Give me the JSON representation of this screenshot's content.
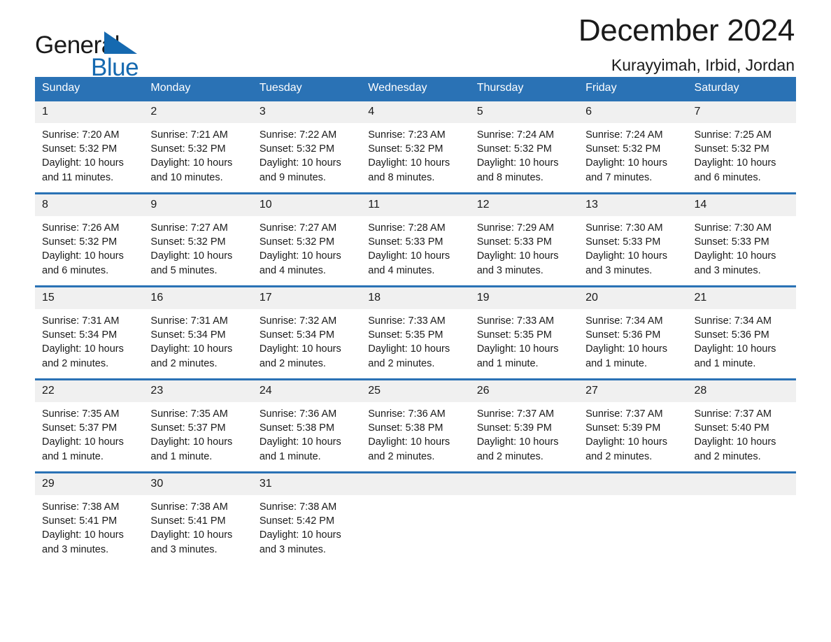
{
  "brand": {
    "name_part1": "General",
    "name_part2": "Blue",
    "logo_icon": "triangle-flag-icon"
  },
  "header": {
    "title": "December 2024",
    "location": "Kurayyimah, Irbid, Jordan"
  },
  "calendar": {
    "weekday_headers": [
      "Sunday",
      "Monday",
      "Tuesday",
      "Wednesday",
      "Thursday",
      "Friday",
      "Saturday"
    ],
    "accent_color": "#2a72b5",
    "daynum_band_color": "#f0f0f0",
    "weeks": [
      [
        {
          "day": "1",
          "sunrise": "Sunrise: 7:20 AM",
          "sunset": "Sunset: 5:32 PM",
          "daylight": "Daylight: 10 hours and 11 minutes."
        },
        {
          "day": "2",
          "sunrise": "Sunrise: 7:21 AM",
          "sunset": "Sunset: 5:32 PM",
          "daylight": "Daylight: 10 hours and 10 minutes."
        },
        {
          "day": "3",
          "sunrise": "Sunrise: 7:22 AM",
          "sunset": "Sunset: 5:32 PM",
          "daylight": "Daylight: 10 hours and 9 minutes."
        },
        {
          "day": "4",
          "sunrise": "Sunrise: 7:23 AM",
          "sunset": "Sunset: 5:32 PM",
          "daylight": "Daylight: 10 hours and 8 minutes."
        },
        {
          "day": "5",
          "sunrise": "Sunrise: 7:24 AM",
          "sunset": "Sunset: 5:32 PM",
          "daylight": "Daylight: 10 hours and 8 minutes."
        },
        {
          "day": "6",
          "sunrise": "Sunrise: 7:24 AM",
          "sunset": "Sunset: 5:32 PM",
          "daylight": "Daylight: 10 hours and 7 minutes."
        },
        {
          "day": "7",
          "sunrise": "Sunrise: 7:25 AM",
          "sunset": "Sunset: 5:32 PM",
          "daylight": "Daylight: 10 hours and 6 minutes."
        }
      ],
      [
        {
          "day": "8",
          "sunrise": "Sunrise: 7:26 AM",
          "sunset": "Sunset: 5:32 PM",
          "daylight": "Daylight: 10 hours and 6 minutes."
        },
        {
          "day": "9",
          "sunrise": "Sunrise: 7:27 AM",
          "sunset": "Sunset: 5:32 PM",
          "daylight": "Daylight: 10 hours and 5 minutes."
        },
        {
          "day": "10",
          "sunrise": "Sunrise: 7:27 AM",
          "sunset": "Sunset: 5:32 PM",
          "daylight": "Daylight: 10 hours and 4 minutes."
        },
        {
          "day": "11",
          "sunrise": "Sunrise: 7:28 AM",
          "sunset": "Sunset: 5:33 PM",
          "daylight": "Daylight: 10 hours and 4 minutes."
        },
        {
          "day": "12",
          "sunrise": "Sunrise: 7:29 AM",
          "sunset": "Sunset: 5:33 PM",
          "daylight": "Daylight: 10 hours and 3 minutes."
        },
        {
          "day": "13",
          "sunrise": "Sunrise: 7:30 AM",
          "sunset": "Sunset: 5:33 PM",
          "daylight": "Daylight: 10 hours and 3 minutes."
        },
        {
          "day": "14",
          "sunrise": "Sunrise: 7:30 AM",
          "sunset": "Sunset: 5:33 PM",
          "daylight": "Daylight: 10 hours and 3 minutes."
        }
      ],
      [
        {
          "day": "15",
          "sunrise": "Sunrise: 7:31 AM",
          "sunset": "Sunset: 5:34 PM",
          "daylight": "Daylight: 10 hours and 2 minutes."
        },
        {
          "day": "16",
          "sunrise": "Sunrise: 7:31 AM",
          "sunset": "Sunset: 5:34 PM",
          "daylight": "Daylight: 10 hours and 2 minutes."
        },
        {
          "day": "17",
          "sunrise": "Sunrise: 7:32 AM",
          "sunset": "Sunset: 5:34 PM",
          "daylight": "Daylight: 10 hours and 2 minutes."
        },
        {
          "day": "18",
          "sunrise": "Sunrise: 7:33 AM",
          "sunset": "Sunset: 5:35 PM",
          "daylight": "Daylight: 10 hours and 2 minutes."
        },
        {
          "day": "19",
          "sunrise": "Sunrise: 7:33 AM",
          "sunset": "Sunset: 5:35 PM",
          "daylight": "Daylight: 10 hours and 1 minute."
        },
        {
          "day": "20",
          "sunrise": "Sunrise: 7:34 AM",
          "sunset": "Sunset: 5:36 PM",
          "daylight": "Daylight: 10 hours and 1 minute."
        },
        {
          "day": "21",
          "sunrise": "Sunrise: 7:34 AM",
          "sunset": "Sunset: 5:36 PM",
          "daylight": "Daylight: 10 hours and 1 minute."
        }
      ],
      [
        {
          "day": "22",
          "sunrise": "Sunrise: 7:35 AM",
          "sunset": "Sunset: 5:37 PM",
          "daylight": "Daylight: 10 hours and 1 minute."
        },
        {
          "day": "23",
          "sunrise": "Sunrise: 7:35 AM",
          "sunset": "Sunset: 5:37 PM",
          "daylight": "Daylight: 10 hours and 1 minute."
        },
        {
          "day": "24",
          "sunrise": "Sunrise: 7:36 AM",
          "sunset": "Sunset: 5:38 PM",
          "daylight": "Daylight: 10 hours and 1 minute."
        },
        {
          "day": "25",
          "sunrise": "Sunrise: 7:36 AM",
          "sunset": "Sunset: 5:38 PM",
          "daylight": "Daylight: 10 hours and 2 minutes."
        },
        {
          "day": "26",
          "sunrise": "Sunrise: 7:37 AM",
          "sunset": "Sunset: 5:39 PM",
          "daylight": "Daylight: 10 hours and 2 minutes."
        },
        {
          "day": "27",
          "sunrise": "Sunrise: 7:37 AM",
          "sunset": "Sunset: 5:39 PM",
          "daylight": "Daylight: 10 hours and 2 minutes."
        },
        {
          "day": "28",
          "sunrise": "Sunrise: 7:37 AM",
          "sunset": "Sunset: 5:40 PM",
          "daylight": "Daylight: 10 hours and 2 minutes."
        }
      ],
      [
        {
          "day": "29",
          "sunrise": "Sunrise: 7:38 AM",
          "sunset": "Sunset: 5:41 PM",
          "daylight": "Daylight: 10 hours and 3 minutes."
        },
        {
          "day": "30",
          "sunrise": "Sunrise: 7:38 AM",
          "sunset": "Sunset: 5:41 PM",
          "daylight": "Daylight: 10 hours and 3 minutes."
        },
        {
          "day": "31",
          "sunrise": "Sunrise: 7:38 AM",
          "sunset": "Sunset: 5:42 PM",
          "daylight": "Daylight: 10 hours and 3 minutes."
        },
        {
          "day": "",
          "sunrise": "",
          "sunset": "",
          "daylight": ""
        },
        {
          "day": "",
          "sunrise": "",
          "sunset": "",
          "daylight": ""
        },
        {
          "day": "",
          "sunrise": "",
          "sunset": "",
          "daylight": ""
        },
        {
          "day": "",
          "sunrise": "",
          "sunset": "",
          "daylight": ""
        }
      ]
    ]
  }
}
